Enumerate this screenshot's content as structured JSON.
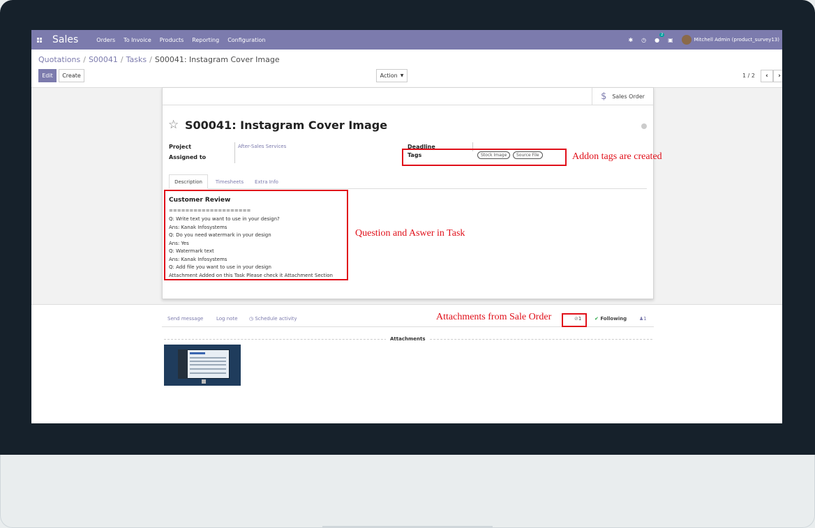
{
  "navbar": {
    "app_name": "Sales",
    "menu": [
      "Orders",
      "To Invoice",
      "Products",
      "Reporting",
      "Configuration"
    ],
    "chat_count": "2",
    "user_name": "Mitchell Admin (product_survey13)",
    "color": "#7c7bad"
  },
  "breadcrumb": {
    "items": [
      "Quotations",
      "S00041",
      "Tasks"
    ],
    "current": "S00041: Instagram Cover Image"
  },
  "control": {
    "edit_label": "Edit",
    "create_label": "Create",
    "action_label": "Action",
    "pager": "1 / 2"
  },
  "sheet": {
    "smart_button": "Sales Order",
    "title": "S00041: Instagram Cover Image",
    "fields": {
      "project_label": "Project",
      "project_value": "After-Sales Services",
      "assigned_label": "Assigned to",
      "deadline_label": "Deadline",
      "tags_label": "Tags",
      "tags": [
        "Stock Image",
        "Source File"
      ]
    },
    "tabs": [
      "Description",
      "Timesheets",
      "Extra Info"
    ],
    "description": {
      "heading": "Customer Review",
      "lines": [
        "====================",
        "Q: Write text you want to use in your design?",
        "Ans: Kanak Infosystems",
        "Q: Do you need watermark in your design",
        "Ans: Yes",
        "Q: Watermark text",
        "Ans: Kanak Infosystems",
        "Q: Add file you want to use in your design",
        "Attachment Added on this Task Please check it Attachment Section"
      ]
    }
  },
  "chatter": {
    "send_message": "Send message",
    "log_note": "Log note",
    "schedule_activity": "Schedule activity",
    "attachment_count": "1",
    "following": "Following",
    "follower_count": "1",
    "attachments_title": "Attachments"
  },
  "annotations": {
    "tags_note": "Addon tags are created",
    "question_note": "Question and Aswer in Task",
    "attachment_note": "Attachments from Sale Order",
    "color": "#e0101a"
  }
}
